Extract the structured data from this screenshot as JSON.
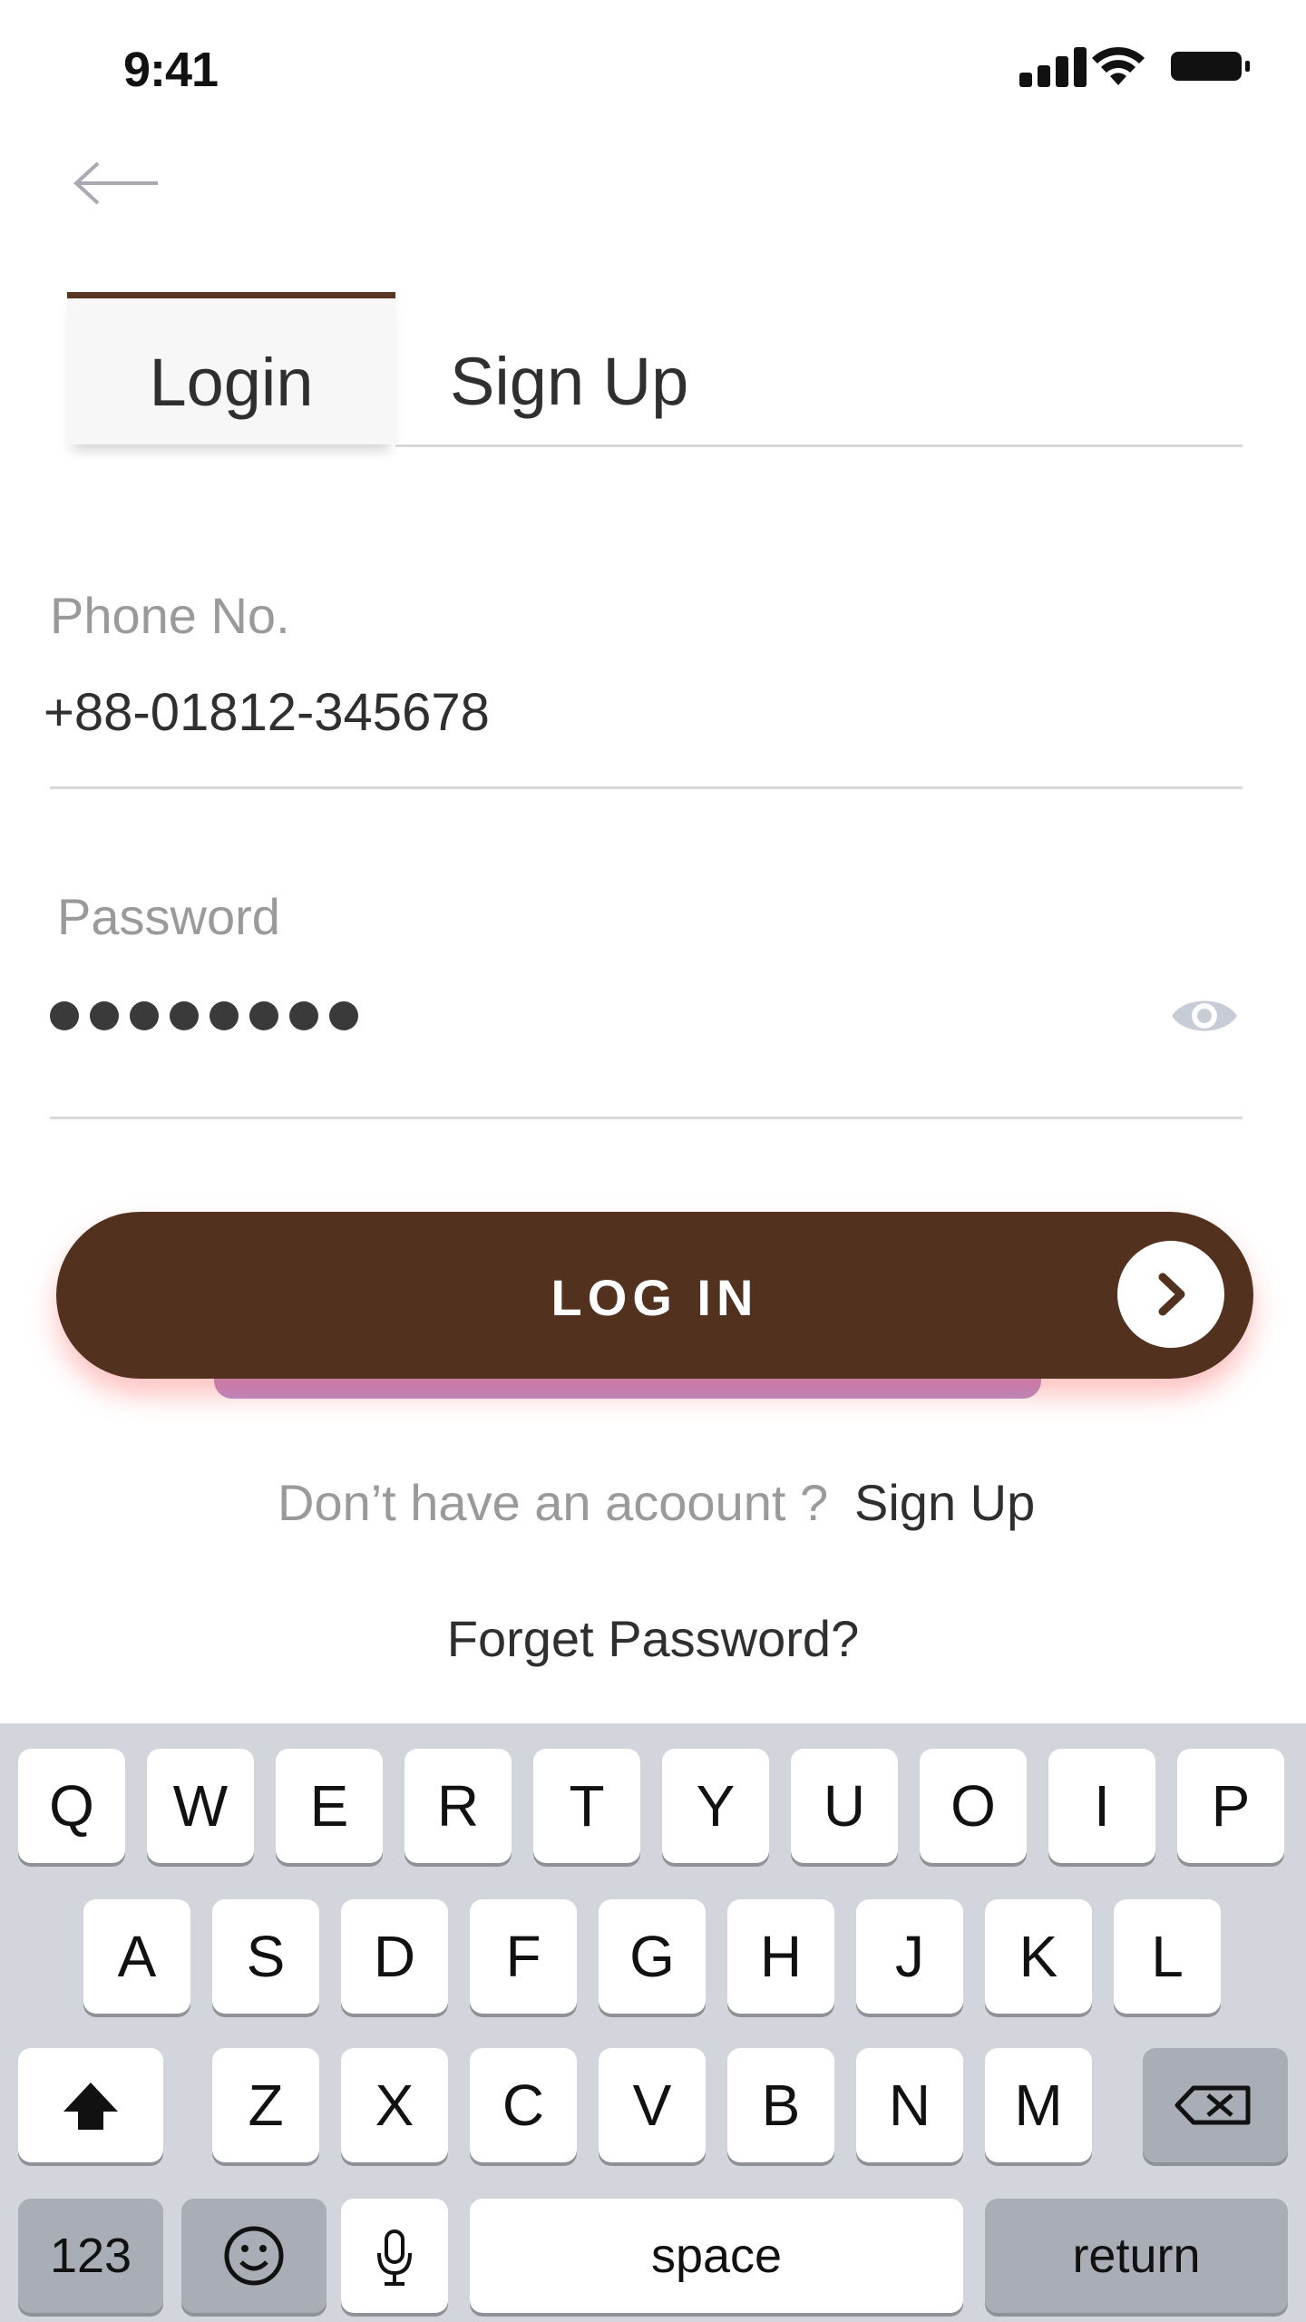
{
  "status_bar": {
    "time": "9:41"
  },
  "tabs": [
    {
      "label": "Login",
      "active": true
    },
    {
      "label": "Sign Up",
      "active": false
    }
  ],
  "form": {
    "phone_label": "Phone No.",
    "phone_value": "+88-01812-345678",
    "password_label": "Password",
    "password_masked_length": 8
  },
  "login_button": {
    "label": "LOG IN"
  },
  "signup_prompt": {
    "text": "Don’t have an acoount ?",
    "link": "Sign Up"
  },
  "forget_link": "Forget Password?",
  "keyboard": {
    "row1": [
      "Q",
      "W",
      "E",
      "R",
      "T",
      "Y",
      "U",
      "O",
      "I",
      "P"
    ],
    "row2": [
      "A",
      "S",
      "D",
      "F",
      "G",
      "H",
      "J",
      "K",
      "L"
    ],
    "row3": [
      "Z",
      "X",
      "C",
      "V",
      "B",
      "N",
      "M"
    ],
    "numbers_key": "123",
    "space_key": "space",
    "return_key": "return"
  },
  "colors": {
    "brand_brown": "#52321f",
    "accent_purple": "#b48dc9",
    "keyboard_bg": "#d2d5dc"
  }
}
